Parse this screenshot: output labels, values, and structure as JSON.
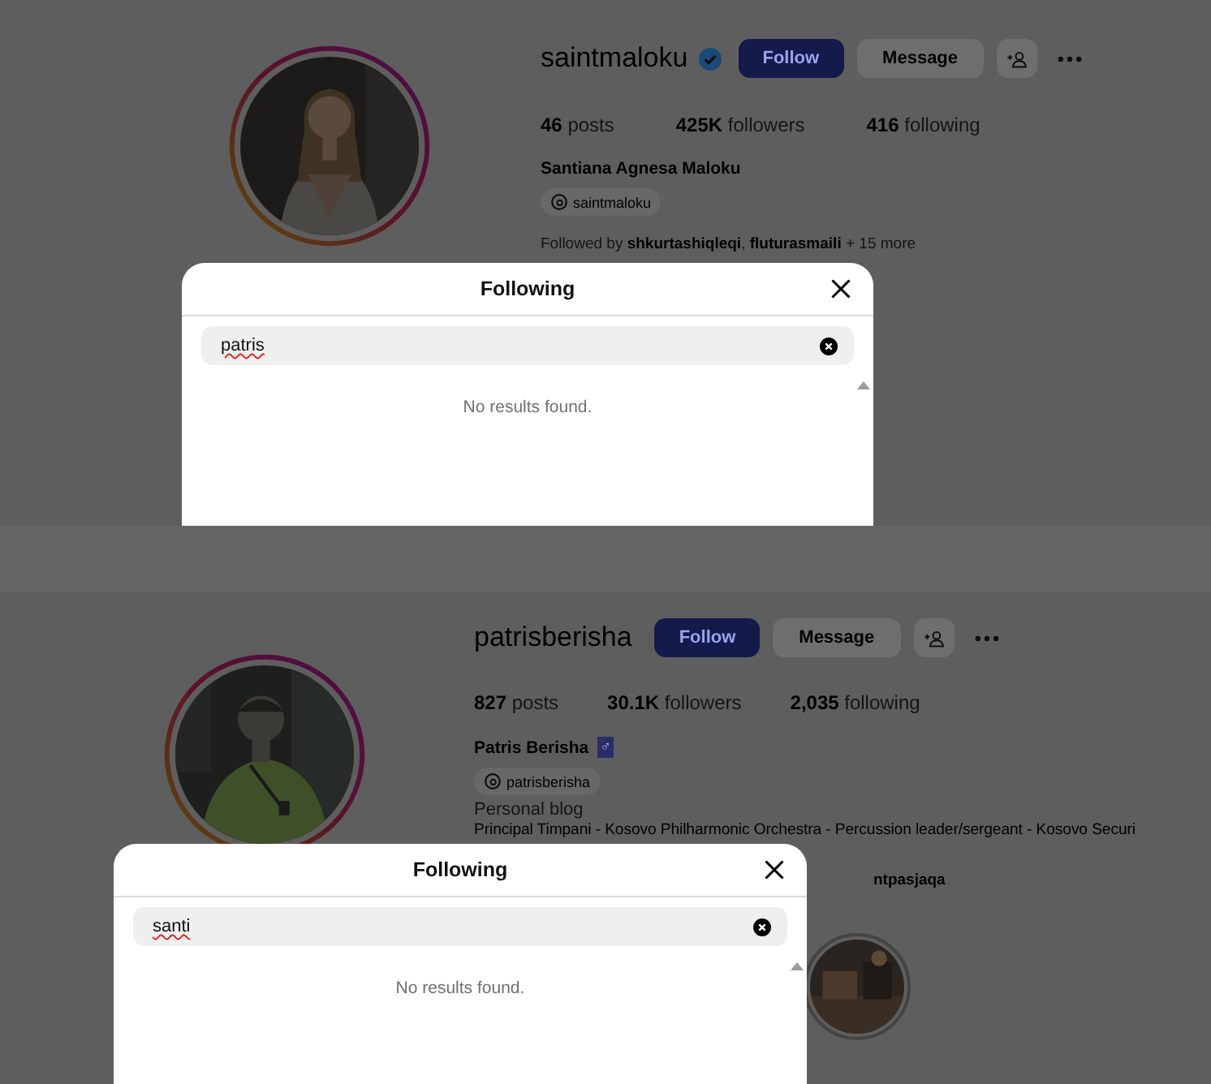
{
  "profiles": [
    {
      "username": "saintmaloku",
      "verified": true,
      "follow_label": "Follow",
      "message_label": "Message",
      "stats": [
        {
          "count": "46",
          "label": "posts"
        },
        {
          "count": "425K",
          "label": "followers"
        },
        {
          "count": "416",
          "label": "following"
        }
      ],
      "full_name": "Santiana Agnesa Maloku",
      "threads_handle": "saintmaloku",
      "followed_by": "Followed by **shkurtashiqleqi**, **fluturasmaili** + 15 more",
      "followed_by_cut": false,
      "modal": {
        "title": "Following",
        "search_value": "patris",
        "message": "No results found."
      }
    },
    {
      "username": "patrisberisha",
      "verified": false,
      "follow_label": "Follow",
      "message_label": "Message",
      "stats": [
        {
          "count": "827",
          "label": "posts"
        },
        {
          "count": "30.1K",
          "label": "followers"
        },
        {
          "count": "2,035",
          "label": "following"
        }
      ],
      "full_name": "Patris Berisha",
      "name_emoji": "♂",
      "threads_handle": "patrisberisha",
      "category": "Personal blog",
      "bio": "Principal Timpani - Kosovo Philharmonic Orchestra - Percussion leader/sergeant - Kosovo Securi",
      "followed_by": "**ntpasjaqa**",
      "followed_by_cut": true,
      "modal": {
        "title": "Following",
        "search_value": "santi",
        "message": "No results found."
      }
    }
  ]
}
